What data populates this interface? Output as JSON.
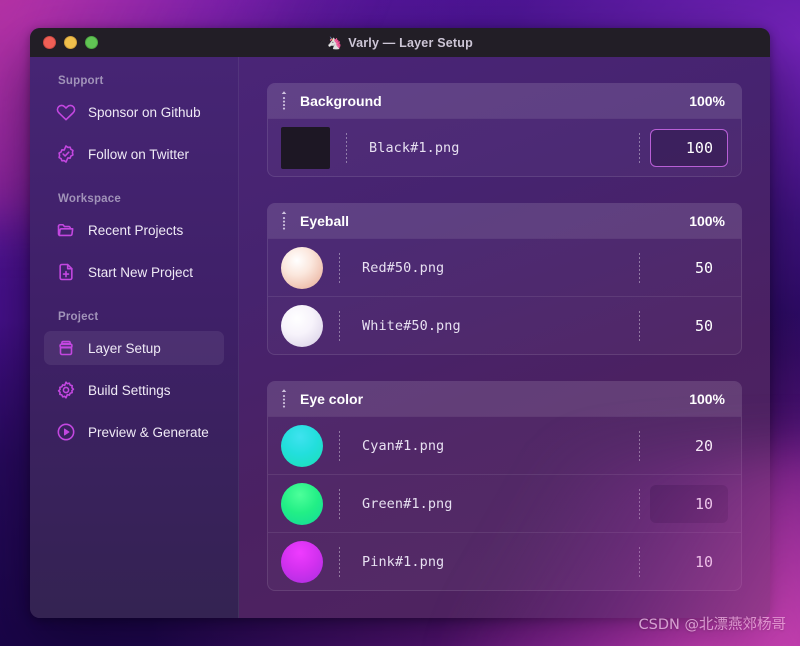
{
  "window": {
    "title": "Varly — Layer Setup",
    "title_emoji": "🦄",
    "traffic_lights": [
      "close-red",
      "minimize-yellow",
      "maximize-green"
    ]
  },
  "sidebar": {
    "sections": [
      {
        "label": "Support",
        "items": [
          {
            "label": "Sponsor on Github",
            "icon": "heart-icon",
            "active": false
          },
          {
            "label": "Follow on Twitter",
            "icon": "check-badge-icon",
            "active": false
          }
        ]
      },
      {
        "label": "Workspace",
        "items": [
          {
            "label": "Recent Projects",
            "icon": "folder-icon",
            "active": false
          },
          {
            "label": "Start New Project",
            "icon": "file-plus-icon",
            "active": false
          }
        ]
      },
      {
        "label": "Project",
        "items": [
          {
            "label": "Layer Setup",
            "icon": "layers-box-icon",
            "active": true
          },
          {
            "label": "Build Settings",
            "icon": "gear-icon",
            "active": false
          },
          {
            "label": "Preview & Generate",
            "icon": "play-circle-icon",
            "active": false
          }
        ]
      }
    ]
  },
  "main": {
    "groups": [
      {
        "name": "Background",
        "percent": "100%",
        "handle_icon": "drag-handle-icon",
        "rows": [
          {
            "file": "Black#1.png",
            "value": "100",
            "swatch": "square",
            "swatch_color": "#1d1724",
            "input_state": "focused"
          }
        ]
      },
      {
        "name": "Eyeball",
        "percent": "100%",
        "handle_icon": "drag-handle-icon",
        "rows": [
          {
            "file": "Red#50.png",
            "value": "50",
            "swatch": "circle",
            "swatch_color": "#f3d9cf",
            "input_state": "none"
          },
          {
            "file": "White#50.png",
            "value": "50",
            "swatch": "circle",
            "swatch_color": "#f2eef6",
            "input_state": "none"
          }
        ]
      },
      {
        "name": "Eye color",
        "percent": "100%",
        "handle_icon": "drag-handle-icon",
        "rows": [
          {
            "file": "Cyan#1.png",
            "value": "20",
            "swatch": "circle",
            "swatch_color": "#22e3d8",
            "input_state": "none"
          },
          {
            "file": "Green#1.png",
            "value": "10",
            "swatch": "circle",
            "swatch_color": "#26ed8a",
            "input_state": "hover"
          },
          {
            "file": "Pink#1.png",
            "value": "10",
            "swatch": "circle",
            "swatch_color": "#d431f0",
            "input_state": "none"
          }
        ]
      }
    ]
  },
  "watermark": "CSDN @北漂燕郊杨哥",
  "colors": {
    "accent": "#c347e0",
    "focus_border": "#b85fd6",
    "sidebar_section_text": "#a193b9",
    "row_text": "#e7e0f1"
  }
}
